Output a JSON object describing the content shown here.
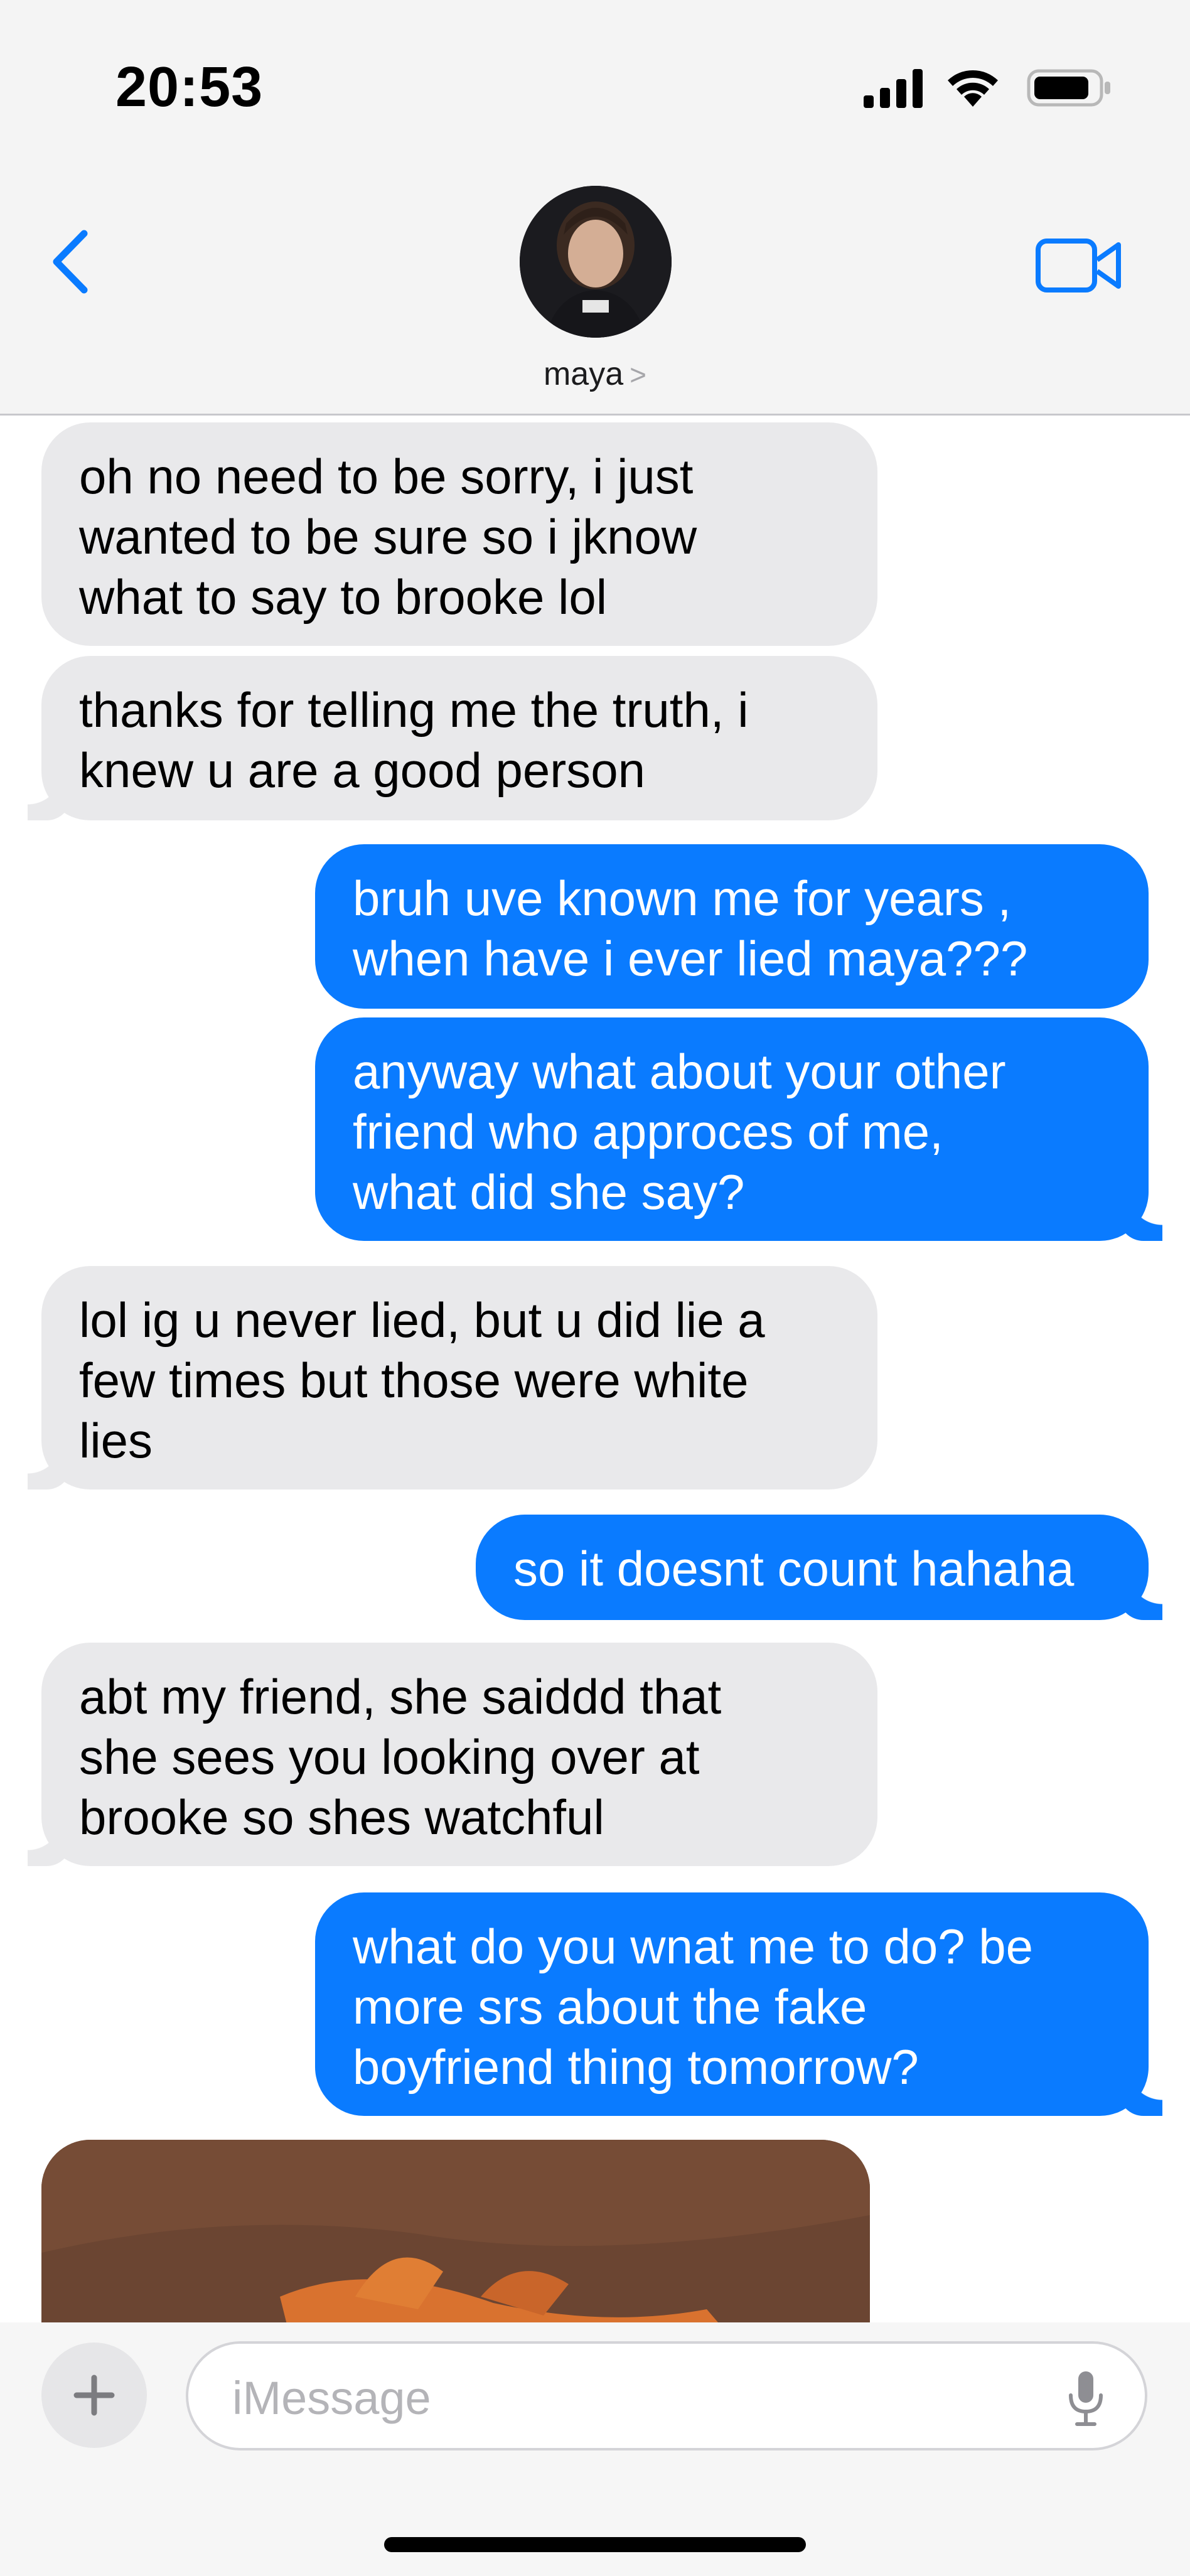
{
  "status_bar": {
    "time": "20:53",
    "icons": [
      "cellular-signal-icon",
      "wifi-icon",
      "battery-icon"
    ]
  },
  "header": {
    "back_icon": "chevron-left-icon",
    "contact_name": "maya",
    "contact_chevron": ">",
    "video_icon": "video-camera-icon"
  },
  "colors": {
    "outgoing_bubble": "#0a7bff",
    "incoming_bubble": "#e9e9eb",
    "accent": "#0a7bff"
  },
  "messages": [
    {
      "sender": "maya",
      "text": "oh no need to be sorry, i just\nwanted to be sure so i jknow\nwhat to say to brooke lol"
    },
    {
      "sender": "maya",
      "text": "thanks for telling me the truth, i\nknew u are a good person"
    },
    {
      "sender": "me",
      "text": "bruh uve known me for years ,\nwhen have i ever lied maya???"
    },
    {
      "sender": "me",
      "text": "anyway what about your other\nfriend who approces of me,\nwhat did she say?"
    },
    {
      "sender": "maya",
      "text": "lol ig u never lied, but u did lie a\nfew times but those were white\nlies"
    },
    {
      "sender": "me",
      "text": "so it doesnt count hahaha"
    },
    {
      "sender": "maya",
      "text": "abt my friend, she saiddd that\nshe sees you looking over at\nbrooke so shes watchful"
    },
    {
      "sender": "me",
      "text": "what do you wnat me to do? be\nmore srs about the fake\nboyfriend thing tomorrow?"
    },
    {
      "sender": "maya",
      "type": "photo"
    }
  ],
  "composer": {
    "plus_icon": "plus-icon",
    "placeholder": "iMessage",
    "value": "",
    "mic_icon": "microphone-icon"
  }
}
